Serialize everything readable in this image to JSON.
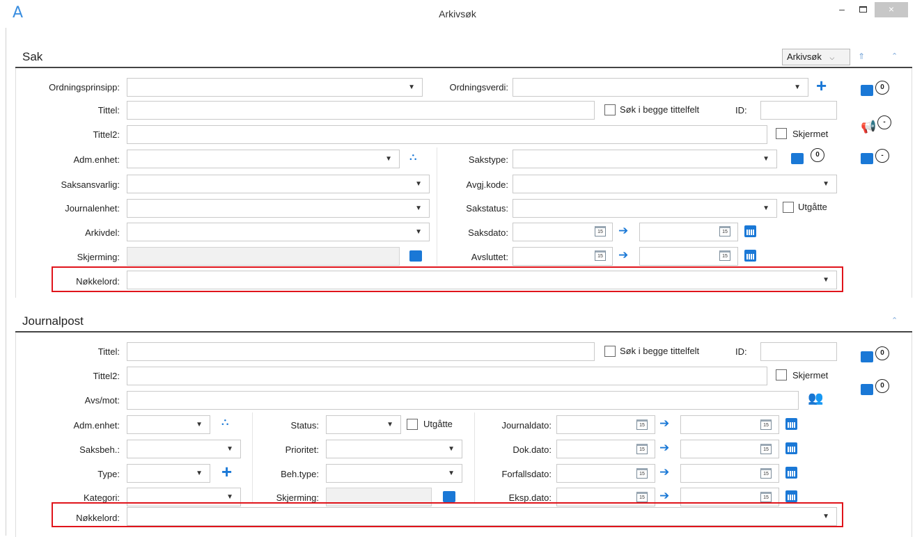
{
  "window": {
    "title": "Arkivsøk",
    "logo": "A",
    "min": "–",
    "close": "×"
  },
  "sak": {
    "header": "Sak",
    "search_mode": "Arkivsøk",
    "labels": {
      "ordningsprinsipp": "Ordningsprinsipp:",
      "ordningsverdi": "Ordningsverdi:",
      "tittel": "Tittel:",
      "sok_begge": "Søk i begge tittelfelt",
      "id": "ID:",
      "tittel2": "Tittel2:",
      "skjermet": "Skjermet",
      "adm_enhet": "Adm.enhet:",
      "sakstype": "Sakstype:",
      "saksansvarlig": "Saksansvarlig:",
      "avgj_kode": "Avgj.kode:",
      "journalenhet": "Journalenhet:",
      "sakstatus": "Sakstatus:",
      "utgatte": "Utgåtte",
      "arkivdel": "Arkivdel:",
      "saksdato": "Saksdato:",
      "skjerming": "Skjerming:",
      "avsluttet": "Avsluttet:",
      "nokkelord": "Nøkkelord:"
    },
    "side_badges": [
      "0",
      "-",
      "-"
    ],
    "sakstype_badge": "0",
    "cal_day": "15"
  },
  "journalpost": {
    "header": "Journalpost",
    "labels": {
      "tittel": "Tittel:",
      "sok_begge": "Søk i begge tittelfelt",
      "id": "ID:",
      "tittel2": "Tittel2:",
      "skjermet": "Skjermet",
      "avs_mot": "Avs/mot:",
      "adm_enhet": "Adm.enhet:",
      "status": "Status:",
      "utgatte": "Utgåtte",
      "journaldato": "Journaldato:",
      "saksbeh": "Saksbeh.:",
      "prioritet": "Prioritet:",
      "dok_dato": "Dok.dato:",
      "type": "Type:",
      "beh_type": "Beh.type:",
      "forfallsdato": "Forfallsdato:",
      "kategori": "Kategori:",
      "skjerming": "Skjerming:",
      "eksp_dato": "Eksp.dato:",
      "nokkelord": "Nøkkelord:"
    },
    "side_badges": [
      "0",
      "0"
    ],
    "cal_day": "15"
  },
  "colors": {
    "accent": "#1a78d6",
    "highlight": "#e0141b"
  }
}
